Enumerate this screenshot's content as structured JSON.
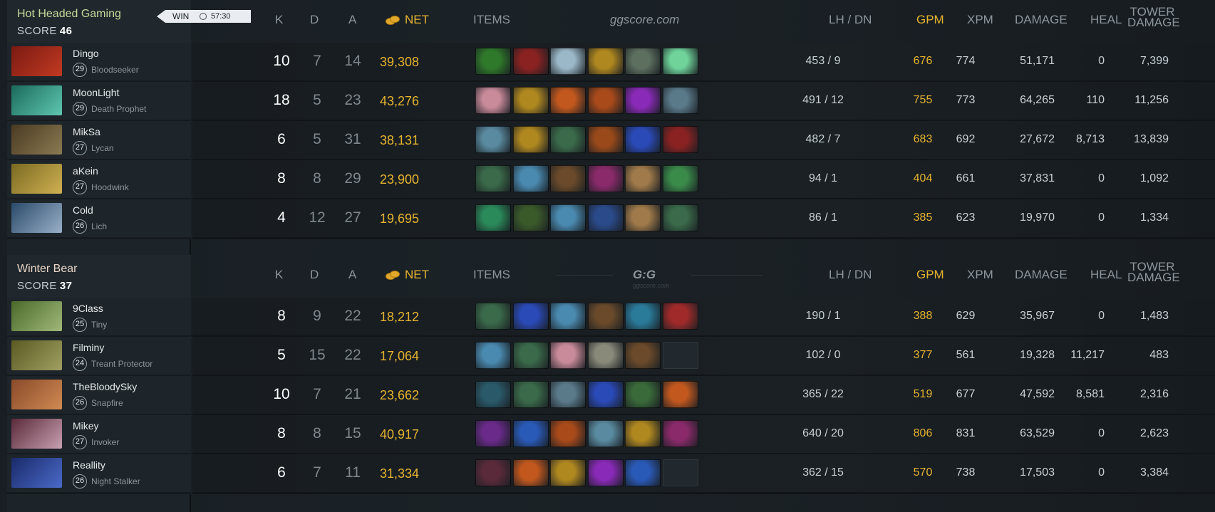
{
  "colors": {
    "gold": "#e6b430",
    "radiant": "#c8d89a",
    "dire": "#e9d6c9"
  },
  "headers": {
    "k": "K",
    "d": "D",
    "a": "A",
    "net": "NET",
    "items": "ITEMS",
    "lhdn": "LH  /  DN",
    "gpm": "GPM",
    "xpm": "XPM",
    "damage": "DAMAGE",
    "heal": "HEAL",
    "tower_1": "TOWER",
    "tower_2": "DAMAGE",
    "watermark": "ggscore.com",
    "logo": "G:G",
    "logo_sub": "ggscore.com"
  },
  "teams": [
    {
      "name": "Hot Headed Gaming",
      "score_label": "SCORE",
      "score": "46",
      "result": "WIN",
      "duration": "57:30",
      "players": [
        {
          "name": "Dingo",
          "level": "29",
          "hero": "Bloodseeker",
          "portrait": [
            "#7a1a12",
            "#c23a22"
          ],
          "k": "10",
          "d": "7",
          "a": "14",
          "net": "39,308",
          "lhdn": "453  /  9",
          "gpm": "676",
          "xpm": "774",
          "damage": "51,171",
          "heal": "0",
          "tower": "7,399",
          "items": [
            "#2f7a2a",
            "#8a2222",
            "#9bb8c8",
            "#b08820",
            "#5d7060",
            "#6fd39a"
          ]
        },
        {
          "name": "MoonLight",
          "level": "29",
          "hero": "Death Prophet",
          "portrait": [
            "#1b6a5a",
            "#5ec7b0"
          ],
          "k": "18",
          "d": "5",
          "a": "23",
          "net": "43,276",
          "lhdn": "491  /  12",
          "gpm": "755",
          "xpm": "773",
          "damage": "64,265",
          "heal": "110",
          "tower": "11,256",
          "items": [
            "#c98a9a",
            "#b08820",
            "#c2581e",
            "#a84a1a",
            "#8a2ab8",
            "#5a7a8a"
          ]
        },
        {
          "name": "MikSa",
          "level": "27",
          "hero": "Lycan",
          "portrait": [
            "#4a3a22",
            "#8a7a52"
          ],
          "k": "6",
          "d": "5",
          "a": "31",
          "net": "38,131",
          "lhdn": "482  /  7",
          "gpm": "683",
          "xpm": "692",
          "damage": "27,672",
          "heal": "8,713",
          "tower": "13,839",
          "items": [
            "#5a8aa0",
            "#b08820",
            "#3a6a4a",
            "#9a4a1a",
            "#2a4ab8",
            "#8a2222"
          ]
        },
        {
          "name": "aKein",
          "level": "27",
          "hero": "Hoodwink",
          "portrait": [
            "#7a6a22",
            "#d0b052"
          ],
          "k": "8",
          "d": "8",
          "a": "29",
          "net": "23,900",
          "lhdn": "94  /  1",
          "gpm": "404",
          "xpm": "661",
          "damage": "37,831",
          "heal": "0",
          "tower": "1,092",
          "items": [
            "#3a6a4a",
            "#4a8ab0",
            "#6a4a2a",
            "#8a2a6a",
            "#a07a4a",
            "#3a8a4a"
          ]
        },
        {
          "name": "Cold",
          "level": "26",
          "hero": "Lich",
          "portrait": [
            "#2a4a6a",
            "#9ab0c8"
          ],
          "k": "4",
          "d": "12",
          "a": "27",
          "net": "19,695",
          "lhdn": "86  /  1",
          "gpm": "385",
          "xpm": "623",
          "damage": "19,970",
          "heal": "0",
          "tower": "1,334",
          "items": [
            "#2a8a5a",
            "#3a5a2a",
            "#4a8ab0",
            "#2a4a8a",
            "#a07a4a",
            "#3a6a4a"
          ]
        }
      ]
    },
    {
      "name": "Winter Bear",
      "score_label": "SCORE",
      "score": "37",
      "players": [
        {
          "name": "9Class",
          "level": "25",
          "hero": "Tiny",
          "portrait": [
            "#4a6a2a",
            "#a0b87a"
          ],
          "k": "8",
          "d": "9",
          "a": "22",
          "net": "18,212",
          "lhdn": "190  /  1",
          "gpm": "388",
          "xpm": "629",
          "damage": "35,967",
          "heal": "0",
          "tower": "1,483",
          "items": [
            "#3a6a4a",
            "#2a4ab8",
            "#4a8ab0",
            "#6a4a2a",
            "#2a7a9a",
            "#a02a2a"
          ]
        },
        {
          "name": "Filminy",
          "level": "24",
          "hero": "Treant Protector",
          "portrait": [
            "#5a5a22",
            "#a0a062"
          ],
          "k": "5",
          "d": "15",
          "a": "22",
          "net": "17,064",
          "lhdn": "102  /  0",
          "gpm": "377",
          "xpm": "561",
          "damage": "19,328",
          "heal": "11,217",
          "tower": "483",
          "items": [
            "#4a8ab0",
            "#3a6a4a",
            "#c98a9a",
            "#8a8a7a",
            "#6a4a2a",
            "empty"
          ]
        },
        {
          "name": "TheBloodySky",
          "level": "26",
          "hero": "Snapfire",
          "portrait": [
            "#8a4a2a",
            "#d08a52"
          ],
          "k": "10",
          "d": "7",
          "a": "21",
          "net": "23,662",
          "lhdn": "365  /  22",
          "gpm": "519",
          "xpm": "677",
          "damage": "47,592",
          "heal": "8,581",
          "tower": "2,316",
          "items": [
            "#2a5a6a",
            "#3a6a4a",
            "#5a7a8a",
            "#2a4ab8",
            "#3a6a3a",
            "#c2581e"
          ]
        },
        {
          "name": "Mikey",
          "level": "27",
          "hero": "Invoker",
          "portrait": [
            "#5a2a3a",
            "#c8a0b0"
          ],
          "k": "8",
          "d": "8",
          "a": "15",
          "net": "40,917",
          "lhdn": "640  /  20",
          "gpm": "806",
          "xpm": "831",
          "damage": "63,529",
          "heal": "0",
          "tower": "2,623",
          "items": [
            "#6a2a8a",
            "#2a5ab8",
            "#a84a1a",
            "#5a8aa0",
            "#b08820",
            "#8a2a6a"
          ]
        },
        {
          "name": "Reallity",
          "level": "26",
          "hero": "Night Stalker",
          "portrait": [
            "#1a2a6a",
            "#4a6ac8"
          ],
          "k": "6",
          "d": "7",
          "a": "11",
          "net": "31,334",
          "lhdn": "362  /  15",
          "gpm": "570",
          "xpm": "738",
          "damage": "17,503",
          "heal": "0",
          "tower": "3,384",
          "items": [
            "#5a2a3a",
            "#c2581e",
            "#b08820",
            "#8a2ab8",
            "#2a5ab8",
            "empty"
          ]
        }
      ]
    }
  ]
}
